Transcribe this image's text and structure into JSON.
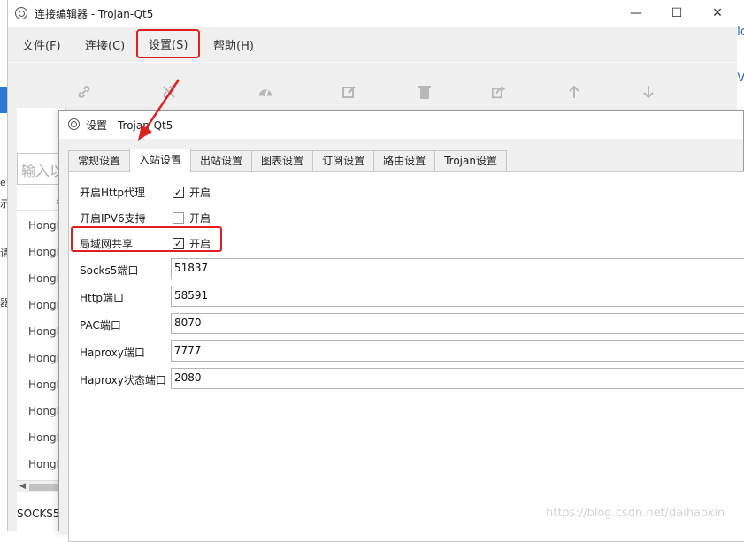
{
  "background": {
    "left_fragments": [
      "e",
      "示",
      "请",
      "器"
    ],
    "right_fragments": [
      "lo",
      "V"
    ]
  },
  "main_window": {
    "title": "连接编辑器 - Trojan-Qt5",
    "controls": {
      "minimize": "—",
      "maximize": "☐",
      "close": "✕"
    },
    "menu": [
      {
        "label": "文件(F)"
      },
      {
        "label": "连接(C)"
      },
      {
        "label": "设置(S)"
      },
      {
        "label": "帮助(H)"
      }
    ],
    "toolbar_icons": [
      "link-icon",
      "unlink-icon",
      "speedometer-icon",
      "edit-icon",
      "trash-icon",
      "share-icon",
      "arrow-up-icon",
      "arrow-down-icon"
    ],
    "search": {
      "placeholder": "输入以"
    },
    "list_header": "名",
    "list_items": [
      "HongKong",
      "HongKong",
      "HongKong",
      "HongKong",
      "HongKong",
      "HongKong",
      "HongKong",
      "HongKong",
      "HongKong",
      "HongKong"
    ],
    "status": "SOCKS5"
  },
  "settings_dialog": {
    "title": "设置 - Trojan-Qt5",
    "tabs": [
      {
        "label": "常规设置",
        "active": false
      },
      {
        "label": "入站设置",
        "active": true
      },
      {
        "label": "出站设置",
        "active": false
      },
      {
        "label": "图表设置",
        "active": false
      },
      {
        "label": "订阅设置",
        "active": false
      },
      {
        "label": "路由设置",
        "active": false
      },
      {
        "label": "Trojan设置",
        "active": false
      }
    ],
    "checkboxes": [
      {
        "label": "开启Http代理",
        "option": "开启",
        "checked": true
      },
      {
        "label": "开启IPV6支持",
        "option": "开启",
        "checked": false
      },
      {
        "label": "局域网共享",
        "option": "开启",
        "checked": true
      }
    ],
    "fields": [
      {
        "label": "Socks5端口",
        "value": "51837"
      },
      {
        "label": "Http端口",
        "value": "58591"
      },
      {
        "label": "PAC端口",
        "value": "8070"
      },
      {
        "label": "Haproxy端口",
        "value": "7777"
      },
      {
        "label": "Haproxy状态端口",
        "value": "2080"
      }
    ]
  },
  "watermark": "https://blog.csdn.net/daihaoxin",
  "colors": {
    "highlight": "#e02020",
    "window_bg": "#f0f0f0",
    "accent": "#2b77d2"
  }
}
